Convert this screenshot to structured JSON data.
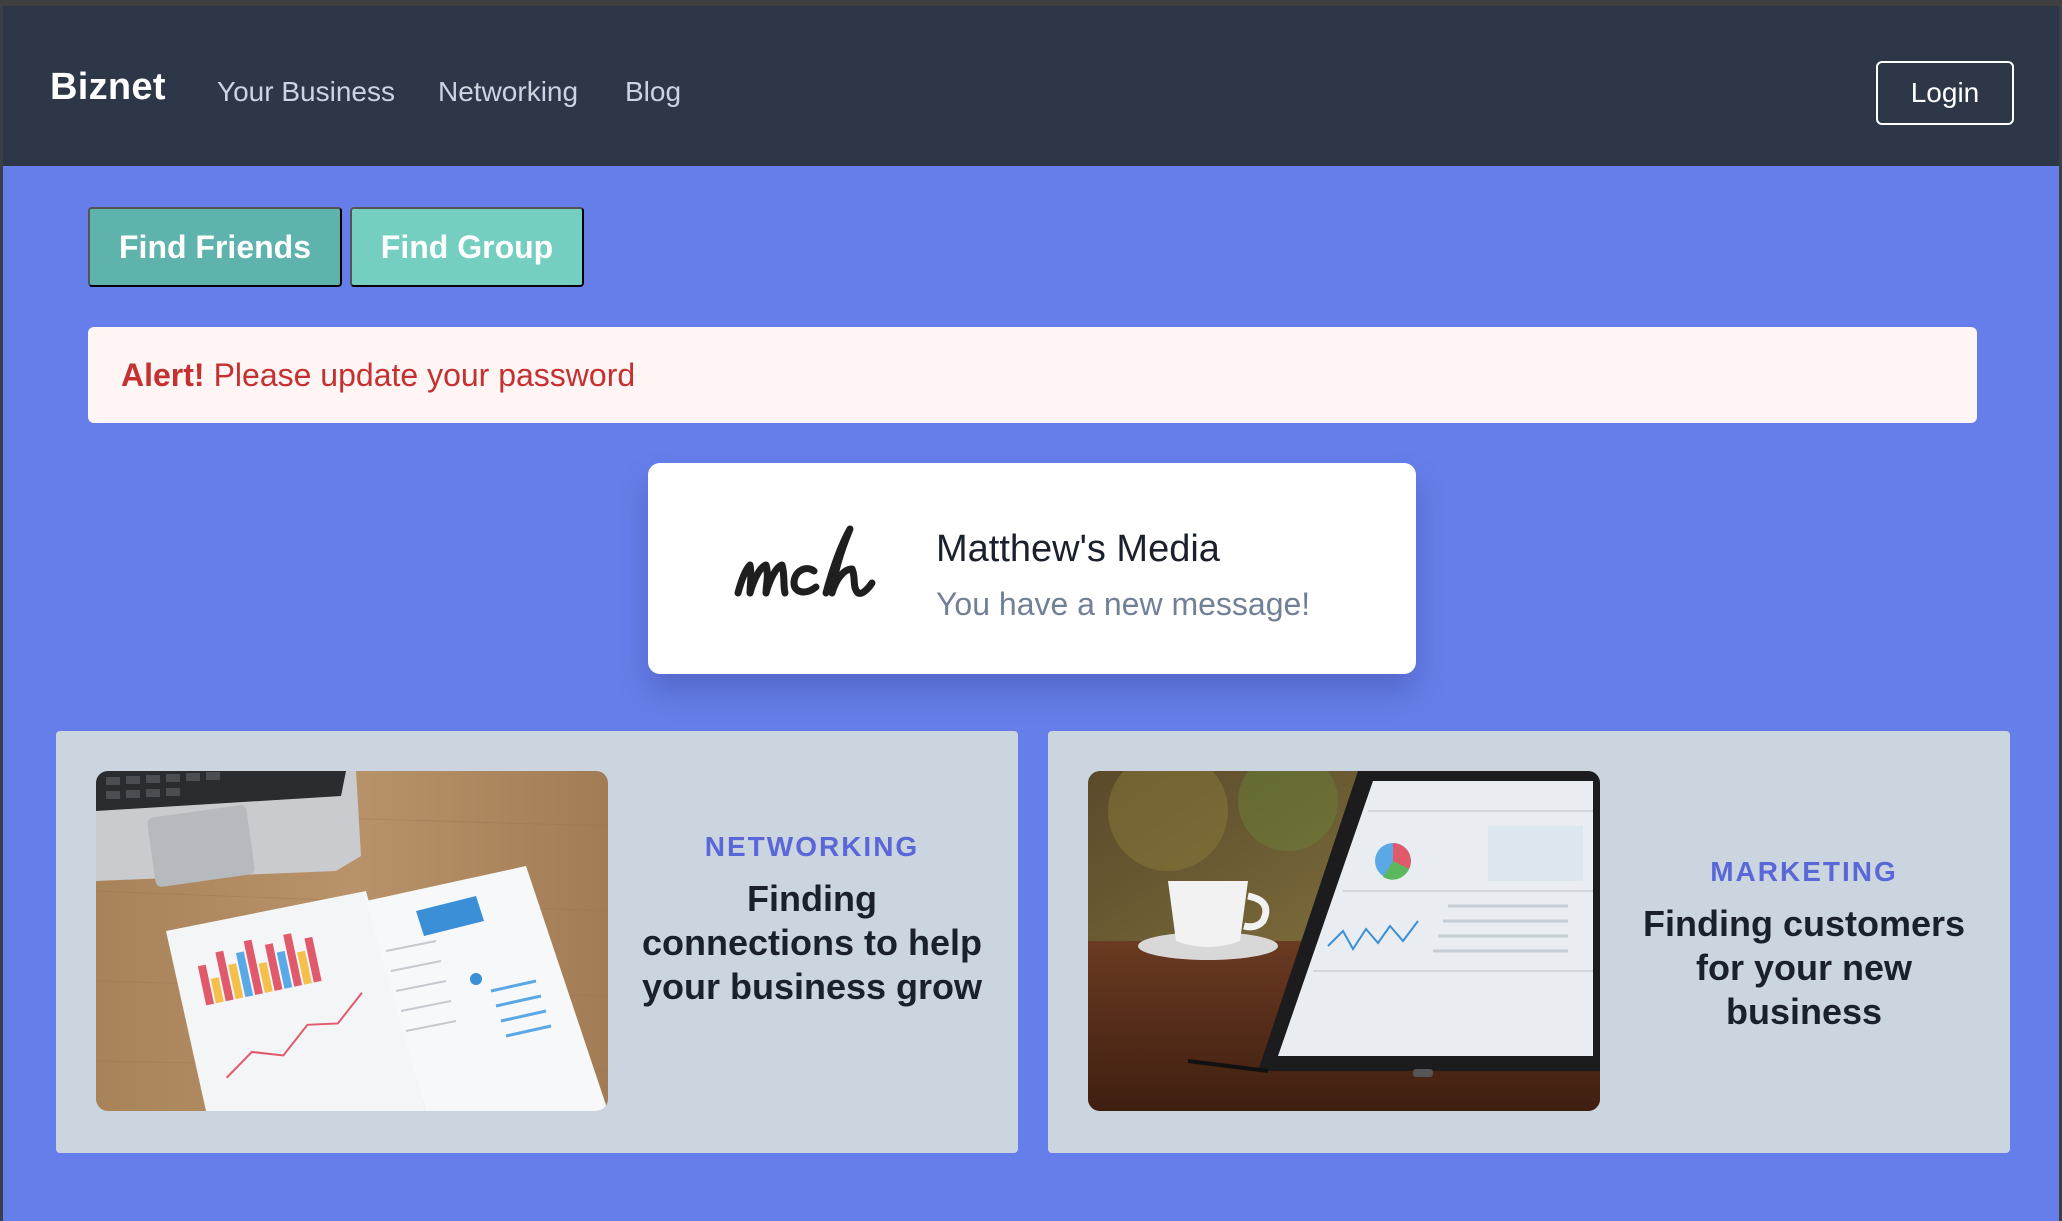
{
  "navbar": {
    "brand": "Biznet",
    "links": [
      "Your Business",
      "Networking",
      "Blog"
    ],
    "login_label": "Login"
  },
  "actions": {
    "find_friends": "Find Friends",
    "find_group": "Find Group"
  },
  "alert": {
    "label": "Alert!",
    "message": "Please update your password"
  },
  "notification": {
    "logo_text": "mch",
    "title": "Matthew's Media",
    "message": "You have a new message!"
  },
  "cards": [
    {
      "category": "NETWORKING",
      "title": "Finding connections to help your business grow",
      "image": "documents-with-charts-and-laptop"
    },
    {
      "category": "MARKETING",
      "title": "Finding customers for your new business",
      "image": "tablet-analytics-dashboard-with-coffee"
    }
  ],
  "colors": {
    "page_bg": "#667eea",
    "navbar_bg": "#2d3748",
    "teal_button": "#5fb3ad",
    "teal_button_light": "#74cfc1",
    "alert_bg": "#fff5f5",
    "alert_text": "#c53030",
    "card_bg": "#cbd5e0",
    "accent": "#5a67d8"
  }
}
